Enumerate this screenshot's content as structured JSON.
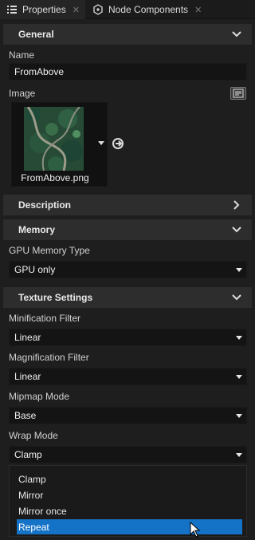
{
  "tabs": [
    {
      "label": "Properties",
      "active": true,
      "icon": "list-icon"
    },
    {
      "label": "Node Components",
      "active": false,
      "icon": "node-components-icon"
    }
  ],
  "sections": {
    "general": "General",
    "description": "Description",
    "memory": "Memory",
    "texture": "Texture Settings"
  },
  "general": {
    "name_label": "Name",
    "name_value": "FromAbove",
    "image_label": "Image",
    "image_file": "FromAbove.png"
  },
  "memory": {
    "gpu_label": "GPU Memory Type",
    "gpu_value": "GPU only"
  },
  "texture": {
    "min_label": "Minification Filter",
    "min_value": "Linear",
    "mag_label": "Magnification Filter",
    "mag_value": "Linear",
    "mip_label": "Mipmap Mode",
    "mip_value": "Base",
    "wrap_label": "Wrap Mode",
    "wrap_value": "Clamp",
    "wrap_options": [
      "Clamp",
      "Mirror",
      "Mirror once",
      "Repeat"
    ],
    "wrap_highlighted": "Repeat"
  },
  "colors": {
    "background": "#1e1e1e",
    "section": "#2d2d2d",
    "selection": "#1573c7"
  }
}
